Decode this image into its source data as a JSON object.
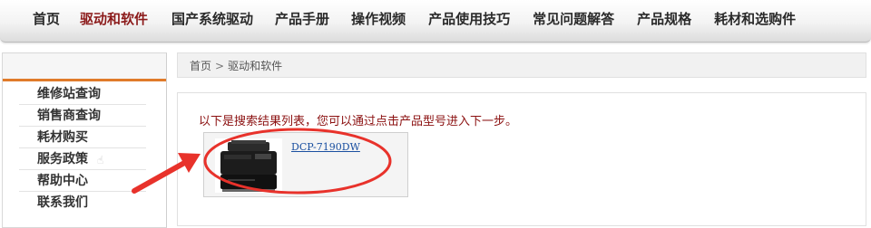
{
  "topnav": {
    "items": [
      {
        "label": "首页"
      },
      {
        "label": "驱动和软件",
        "active": true
      },
      {
        "label": "国产系统驱动"
      },
      {
        "label": "产品手册"
      },
      {
        "label": "操作视频"
      },
      {
        "label": "产品使用技巧"
      },
      {
        "label": "常见问题解答"
      },
      {
        "label": "产品规格"
      },
      {
        "label": "耗材和选购件"
      }
    ]
  },
  "sidebar": {
    "items": [
      {
        "label": "维修站查询"
      },
      {
        "label": "销售商查询"
      },
      {
        "label": "耗材购买"
      },
      {
        "label": "服务政策",
        "icon": "hand-pointer-icon"
      },
      {
        "label": "帮助中心"
      },
      {
        "label": "联系我们"
      }
    ]
  },
  "breadcrumb": {
    "home": "首页",
    "separator": ">",
    "current": "驱动和软件"
  },
  "main": {
    "notice": "以下是搜索结果列表，您可以通过点击产品型号进入下一步。",
    "result": {
      "model": "DCP-7190DW",
      "image_icon": "printer-icon"
    }
  },
  "annotations": {
    "color": "#e8322b",
    "shapes": [
      "red-arrow",
      "red-ellipse"
    ]
  },
  "colors": {
    "accent": "#8b1a1a",
    "sidebar_underline": "#e07b2a",
    "link": "#1a4fa0",
    "notice": "#8b1010"
  }
}
